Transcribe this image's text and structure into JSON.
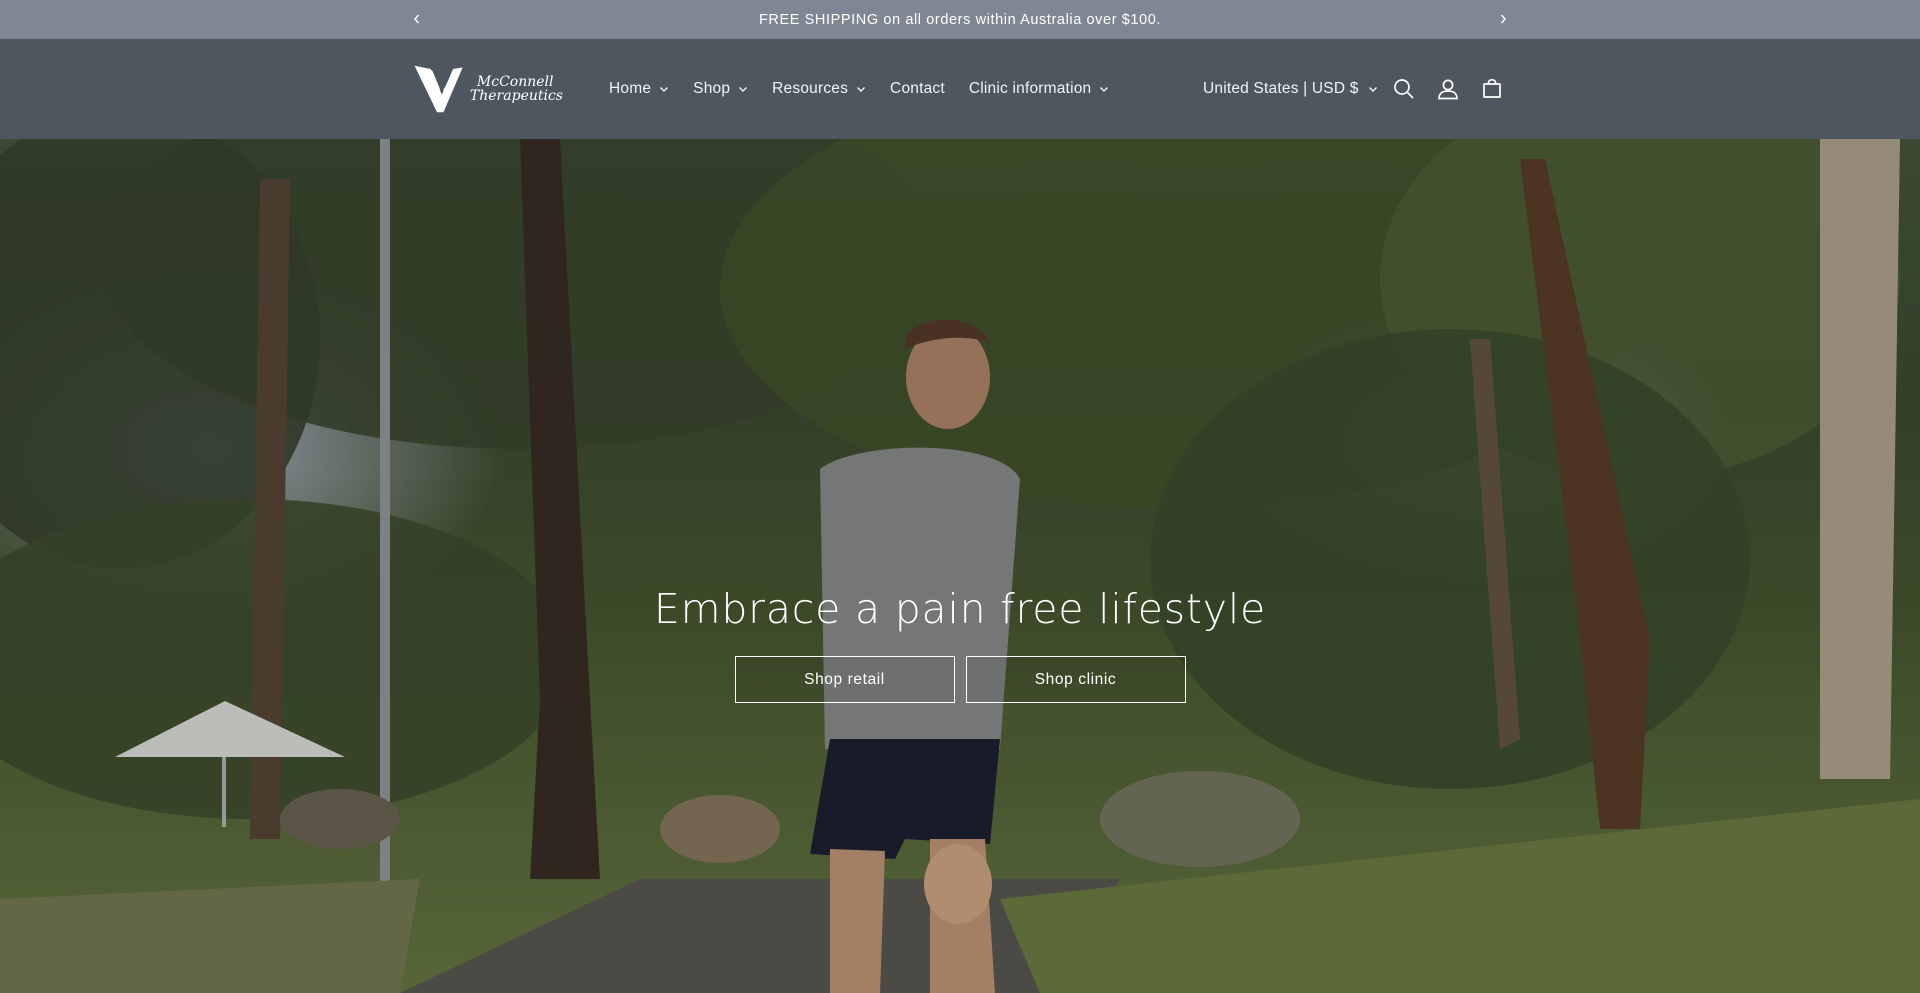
{
  "announcement": {
    "text": "FREE SHIPPING on all orders within Australia over $100.",
    "prev_icon": "chevron-left-icon",
    "next_icon": "chevron-right-icon"
  },
  "header": {
    "logo": {
      "line1": "McConnell",
      "line2": "Therapeutics"
    },
    "nav": [
      {
        "label": "Home",
        "has_dropdown": true
      },
      {
        "label": "Shop",
        "has_dropdown": true
      },
      {
        "label": "Resources",
        "has_dropdown": true
      },
      {
        "label": "Contact",
        "has_dropdown": false
      },
      {
        "label": "Clinic information",
        "has_dropdown": true
      }
    ],
    "country_selector": "United States | USD $",
    "icons": [
      "search-icon",
      "account-icon",
      "cart-icon"
    ]
  },
  "hero": {
    "title": "Embrace a pain free lifestyle",
    "buttons": [
      {
        "label": "Shop retail"
      },
      {
        "label": "Shop clinic"
      }
    ]
  },
  "colors": {
    "announcement_bg": "#7e8793",
    "header_bg": "#4e5760",
    "text": "#ffffff"
  }
}
